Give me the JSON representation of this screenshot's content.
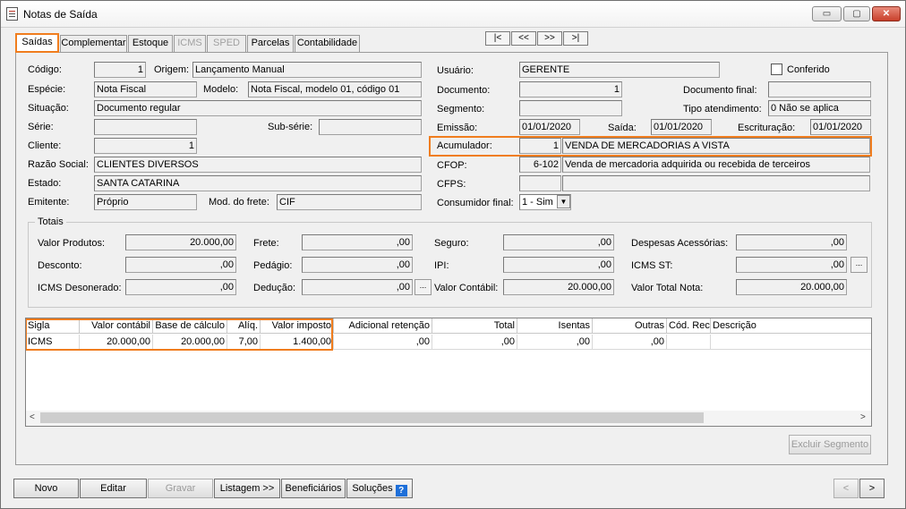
{
  "window": {
    "title": "Notas de Saída"
  },
  "title_buttons": {
    "minimize": "▭",
    "maximize": "▢",
    "close": "✕"
  },
  "tabs": [
    {
      "label": "Saídas",
      "active": true,
      "enabled": true
    },
    {
      "label": "Complementar",
      "enabled": true
    },
    {
      "label": "Estoque",
      "enabled": true
    },
    {
      "label": "ICMS",
      "enabled": false
    },
    {
      "label": "SPED",
      "enabled": false
    },
    {
      "label": "Parcelas",
      "enabled": true
    },
    {
      "label": "Contabilidade",
      "enabled": true
    }
  ],
  "record_nav": {
    "first": "|<",
    "prev": "<<",
    "next": ">>",
    "last": ">|"
  },
  "form": {
    "codigo": {
      "label": "Código:",
      "value": "1"
    },
    "origem": {
      "label": "Origem:",
      "value": "Lançamento Manual"
    },
    "especie": {
      "label": "Espécie:",
      "value": "Nota Fiscal"
    },
    "modelo": {
      "label": "Modelo:",
      "value": "Nota Fiscal, modelo 01, código 01"
    },
    "situacao": {
      "label": "Situação:",
      "value": "Documento regular"
    },
    "serie": {
      "label": "Série:",
      "value": ""
    },
    "subserie": {
      "label": "Sub-série:",
      "value": ""
    },
    "cliente": {
      "label": "Cliente:",
      "value": "1"
    },
    "razao_social": {
      "label": "Razão Social:",
      "value": "CLIENTES DIVERSOS"
    },
    "estado": {
      "label": "Estado:",
      "value": "SANTA CATARINA"
    },
    "emitente": {
      "label": "Emitente:",
      "value": "Próprio"
    },
    "mod_frete": {
      "label": "Mod. do frete:",
      "value": "CIF"
    },
    "usuario": {
      "label": "Usuário:",
      "value": "GERENTE"
    },
    "conferido": {
      "label": "Conferido",
      "checked": false
    },
    "documento": {
      "label": "Documento:",
      "value": "1"
    },
    "documento_final": {
      "label": "Documento final:",
      "value": ""
    },
    "segmento": {
      "label": "Segmento:",
      "value": ""
    },
    "tipo_atendimento": {
      "label": "Tipo atendimento:",
      "value": "0 Não se aplica"
    },
    "emissao": {
      "label": "Emissão:",
      "value": "01/01/2020"
    },
    "saida": {
      "label": "Saída:",
      "value": "01/01/2020"
    },
    "escrituracao": {
      "label": "Escrituração:",
      "value": "01/01/2020"
    },
    "acumulador": {
      "label": "Acumulador:",
      "code": "1",
      "value": "VENDA DE MERCADORIAS A VISTA"
    },
    "cfop": {
      "label": "CFOP:",
      "code": "6-102",
      "value": "Venda de mercadoria adquirida ou recebida de terceiros"
    },
    "cfps": {
      "label": "CFPS:",
      "code": "",
      "value": ""
    },
    "consumidor_final": {
      "label": "Consumidor final:",
      "value": "1 - Sim"
    }
  },
  "totais": {
    "title": "Totais",
    "valor_produtos": {
      "label": "Valor Produtos:",
      "value": "20.000,00"
    },
    "frete": {
      "label": "Frete:",
      "value": ",00"
    },
    "seguro": {
      "label": "Seguro:",
      "value": ",00"
    },
    "despesas_acessorias": {
      "label": "Despesas Acessórias:",
      "value": ",00"
    },
    "desconto": {
      "label": "Desconto:",
      "value": ",00"
    },
    "pedagio": {
      "label": "Pedágio:",
      "value": ",00"
    },
    "ipi": {
      "label": "IPI:",
      "value": ",00"
    },
    "icms_st": {
      "label": "ICMS ST:",
      "value": ",00"
    },
    "icms_desonerado": {
      "label": "ICMS Desonerado:",
      "value": ",00"
    },
    "deducao": {
      "label": "Dedução:",
      "value": ",00"
    },
    "valor_contabil": {
      "label": "Valor Contábil:",
      "value": "20.000,00"
    },
    "valor_total_nota": {
      "label": "Valor Total Nota:",
      "value": "20.000,00"
    },
    "ellipsis": "..."
  },
  "grid": {
    "columns": [
      "Sigla",
      "Valor contábil",
      "Base de cálculo",
      "Alíq.",
      "Valor imposto",
      "Adicional retenção",
      "Total",
      "Isentas",
      "Outras",
      "Cód. Rec.",
      "Descrição"
    ],
    "rows": [
      [
        "ICMS",
        "20.000,00",
        "20.000,00",
        "7,00",
        "1.400,00",
        ",00",
        ",00",
        ",00",
        ",00",
        "",
        ""
      ]
    ],
    "scroll_left": "<",
    "scroll_right": ">"
  },
  "excluir_segmento": "Excluir Segmento",
  "footer": {
    "novo": "Novo",
    "editar": "Editar",
    "gravar": "Gravar",
    "listagem": "Listagem >>",
    "beneficiarios": "Beneficiários",
    "solucoes": "Soluções",
    "help": "?",
    "prev": "<",
    "next": ">"
  },
  "colors": {
    "highlight": "#f07d1e",
    "help_icon": "#1e6fd9"
  }
}
